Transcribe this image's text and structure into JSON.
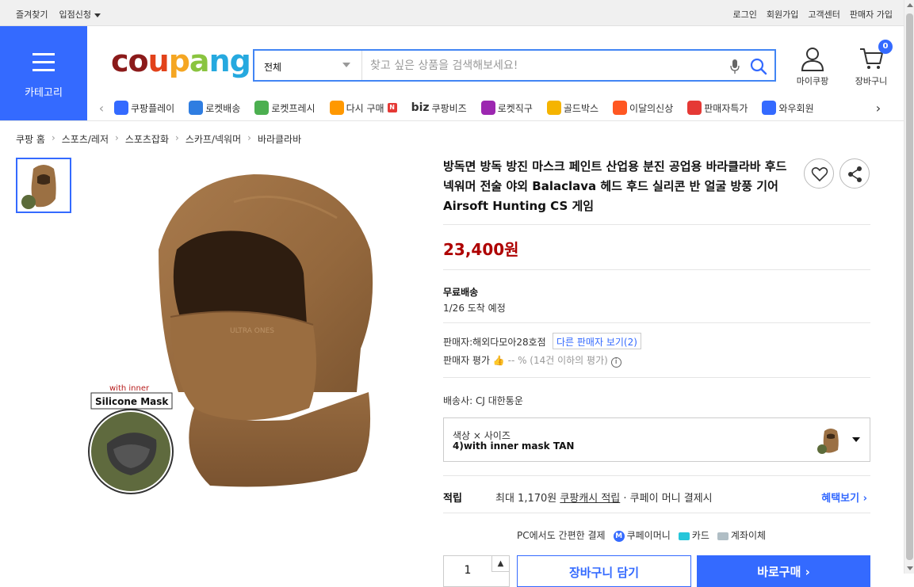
{
  "topbar": {
    "left": [
      "즐겨찾기",
      "입점신청"
    ],
    "right": [
      "로그인",
      "회원가입",
      "고객센터",
      "판매자 가입"
    ]
  },
  "category_label": "카테고리",
  "logo_text": "coupang",
  "search": {
    "category": "전체",
    "placeholder": "찾고 싶은 상품을 검색해보세요!"
  },
  "user": {
    "mypage": "마이쿠팡",
    "cart": "장바구니",
    "cart_count": "0"
  },
  "quick_menu": [
    {
      "label": "쿠팡플레이",
      "icon": "play-icon",
      "color": "#346aff"
    },
    {
      "label": "로켓배송",
      "icon": "rocket-icon",
      "color": "#2f7de1"
    },
    {
      "label": "로켓프레시",
      "icon": "rocket-fresh-icon",
      "color": "#4caf50"
    },
    {
      "label": "다시 구매",
      "icon": "rebuy-icon",
      "color": "#ff9800",
      "badge": "N"
    },
    {
      "label": "쿠팡비즈",
      "icon": "biz-icon",
      "color": "#333333",
      "prefix": "biz"
    },
    {
      "label": "로켓직구",
      "icon": "rocket-global-icon",
      "color": "#9c27b0"
    },
    {
      "label": "골드박스",
      "icon": "goldbox-icon",
      "color": "#f5b400"
    },
    {
      "label": "이달의신상",
      "icon": "new-arrival-icon",
      "color": "#ff5722"
    },
    {
      "label": "판매자특가",
      "icon": "percent-icon",
      "color": "#e53935"
    },
    {
      "label": "와우회원",
      "icon": "wow-icon",
      "color": "#346aff"
    }
  ],
  "breadcrumb": [
    "쿠팡 홈",
    "스포츠/레저",
    "스포츠잡화",
    "스카프/넥워머",
    "바라클라바"
  ],
  "product": {
    "title": "방독면 방독 방진 마스크 페인트 산업용 분진 공업용 바라클라바 후드넥워머 전술 야외 Balaclava 헤드 후드 실리콘 반 얼굴 방풍 기어 Airsoft Hunting CS 게임",
    "price": "23,400원",
    "image_labels": {
      "inner": "with inner",
      "mask": "Silicone Mask",
      "watermark": "ULTRA ONES"
    },
    "shipping_label": "무료배송",
    "arrival": "1/26 도착 예정",
    "seller": "판매자:해외다모아28호점",
    "other_sellers": "다른 판매자 보기(2)",
    "seller_rating_label": "판매자 평가",
    "seller_rating_value": "-- % (14건 이하의 평가)",
    "carrier": "배송사:  CJ 대한통운",
    "option_label": "색상 × 사이즈",
    "option_value": "4)with inner mask TAN",
    "points_label": "적립",
    "points_max": "최대 1,170원",
    "points_cash": "쿠팡캐시 적립",
    "points_rest": "· 쿠페이 머니 결제시",
    "benefit_link": "혜택보기",
    "pay_intro": "PC에서도 간편한 결제",
    "pay_methods": [
      "쿠페이머니",
      "카드",
      "계좌이체"
    ],
    "quantity": "1",
    "cart_button": "장바구니 담기",
    "buy_button": "바로구매"
  },
  "colors": {
    "accent": "#346aff",
    "price": "#ae0000",
    "product_tan": "#9b7043"
  }
}
